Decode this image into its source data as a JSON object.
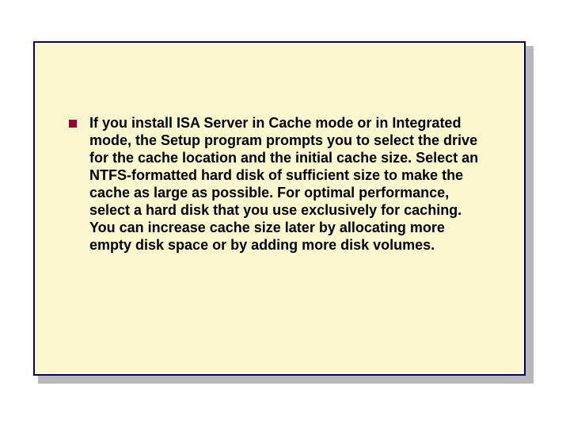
{
  "slide": {
    "bullets": [
      {
        "text": "If you install ISA Server in Cache mode or in Integrated mode, the Setup program prompts you to select the drive for the cache location and the initial cache size. Select an NTFS-formatted hard disk of sufficient size to make the cache as large as possible. For optimal performance, select a hard disk that you use exclusively for caching. You can increase cache size later by allocating more empty disk space or by adding more disk volumes."
      }
    ]
  }
}
